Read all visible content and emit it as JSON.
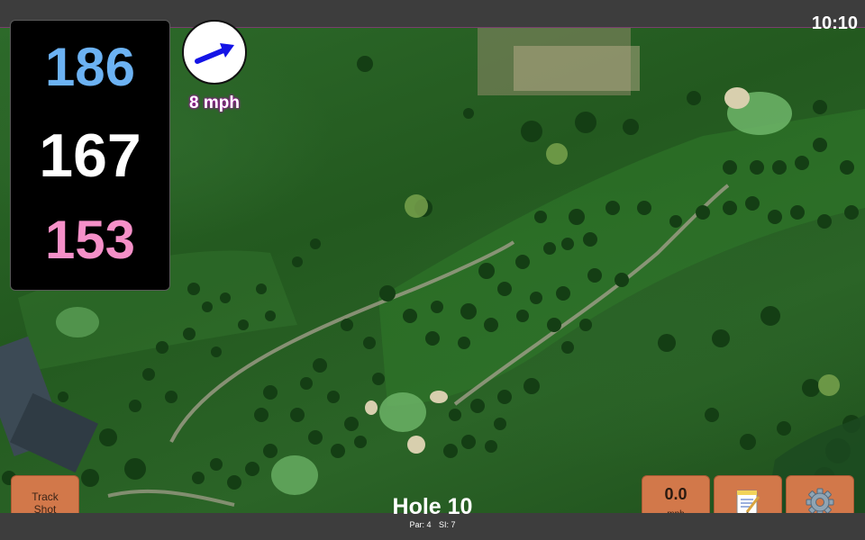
{
  "status_bar": {
    "time": "10:10"
  },
  "distances": {
    "back": "186",
    "middle": "167",
    "front": "153"
  },
  "wind": {
    "speed_label": "8 mph",
    "direction_icon": "wind-arrow-icon"
  },
  "buttons": {
    "track_shot_line1": "Track",
    "track_shot_line2": "Shot",
    "speed_value": "0.0",
    "speed_unit": "mph",
    "notes_icon": "notepad-icon",
    "settings_icon": "gear-icon"
  },
  "hole": {
    "title": "Hole 10",
    "par": "Par: 4",
    "stroke_index": "SI: 7"
  },
  "colors": {
    "back_distance": "#6cb2f3",
    "middle_distance": "#ffffff",
    "front_distance": "#f590c8",
    "button": "#d2784a",
    "wind_arrow": "#1414e6"
  }
}
